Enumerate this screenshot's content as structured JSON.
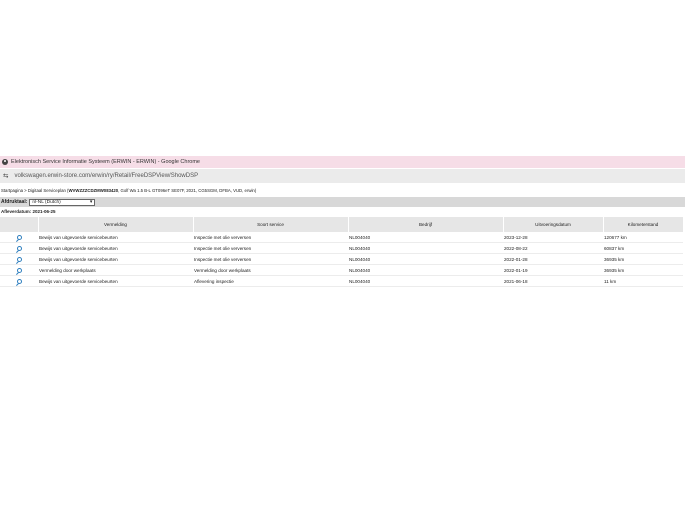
{
  "window": {
    "title": "Elektronisch Service Informatie Systeem (ERWIN - ERWIN) - Google Chrome"
  },
  "address_bar": {
    "url": "volkswagen.erwin-store.com/erwin/ry/Retail/FreeDSPView/ShowDSP"
  },
  "breadcrumb": {
    "prefix": "Startpagina > Digitaal Serviceplan (",
    "vin": "WVWZZZCDZMW083420",
    "suffix": ", Golf Wa 1.5 B-L GT096eT SE07F, 2021, CG5SGM, DFBA, VUD, erwin)"
  },
  "language": {
    "label": "Afdruktaal:",
    "selected": "nl-NL (Dutch)"
  },
  "delivery_date": "Afleverdatum: 2021-06-25",
  "table": {
    "headers": [
      "",
      "Vermelding",
      "Soort service",
      "Bedrijf",
      "Uitvoeringsdatum",
      "Kilometerstand"
    ],
    "rows": [
      [
        "Bewijs van uitgevoerde servicebeurten",
        "Inspectie met olie verversen",
        "NL004040",
        "2023-12-28",
        "120677 km"
      ],
      [
        "Bewijs van uitgevoerde servicebeurten",
        "Inspectie met olie verversen",
        "NL004040",
        "2022-08-22",
        "60837 km"
      ],
      [
        "Bewijs van uitgevoerde servicebeurten",
        "Inspectie met olie verversen",
        "NL004040",
        "2022-01-28",
        "36935 km"
      ],
      [
        "Vermelding door werkplaats",
        "Vermelding door werkplaats",
        "NL004040",
        "2022-01-19",
        "36935 km"
      ],
      [
        "Bewijs van uitgevoerde servicebeurten",
        "Aflevering inspectie",
        "NL004040",
        "2021-06-18",
        "11 km"
      ]
    ]
  },
  "icons": {
    "app": "chrome-app-icon",
    "site_info": "tune-icon",
    "row_detail": "magnifier-icon",
    "dropdown": "chevron-down-icon"
  }
}
